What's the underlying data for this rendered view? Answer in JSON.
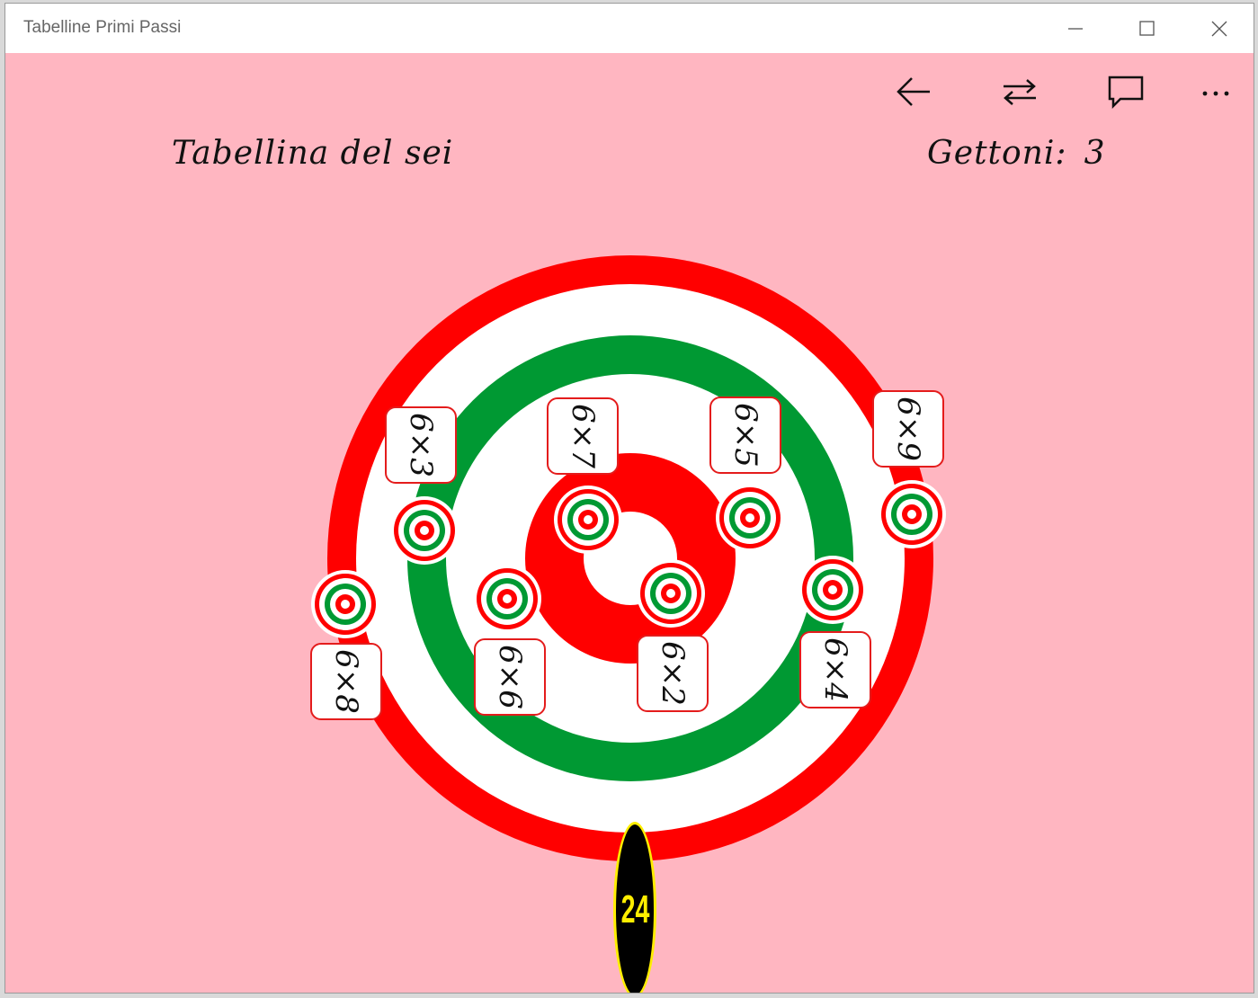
{
  "window": {
    "title": "Tabelline Primi Passi"
  },
  "header": {
    "table_title": "Tabellina del sei",
    "tokens_label": "Gettoni:",
    "tokens_value": "3"
  },
  "commands": [
    {
      "name": "back-icon"
    },
    {
      "name": "swap-icon"
    },
    {
      "name": "comment-icon"
    },
    {
      "name": "more-icon"
    }
  ],
  "cards": [
    "6×3",
    "6×7",
    "6×5",
    "6×9",
    "6×8",
    "6×6",
    "6×2",
    "6×4"
  ],
  "answer_ball": {
    "value": "24",
    "color": "#ffee00"
  },
  "colors": {
    "background": "#ffb6c1",
    "red": "#ff0000",
    "green": "#009933",
    "white": "#ffffff"
  }
}
